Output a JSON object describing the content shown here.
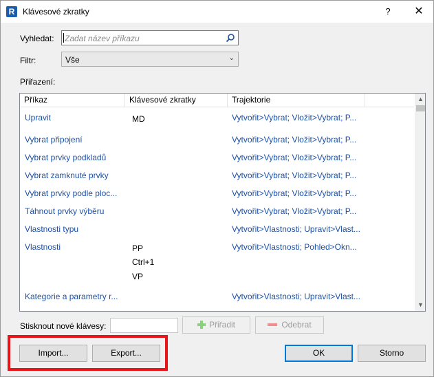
{
  "window": {
    "title": "Klávesové zkratky",
    "app_icon_letter": "R",
    "help_label": "?",
    "close_label": "✕"
  },
  "search": {
    "label": "Vyhledat:",
    "placeholder": "Zadat název příkazu",
    "icon": "search-icon"
  },
  "filter": {
    "label": "Filtr:",
    "value": "Vše",
    "chevron": "⌄"
  },
  "assignments": {
    "label": "Přiřazení:",
    "columns": [
      "Příkaz",
      "Klávesové zkratky",
      "Trajektorie"
    ],
    "rows": [
      {
        "command": "Upravit",
        "keys": [
          "MD"
        ],
        "path": "Vytvořit>Vybrat; Vložit>Vybrat; P..."
      },
      {
        "command": "Vybrat připojení",
        "keys": [],
        "path": "Vytvořit>Vybrat; Vložit>Vybrat; P..."
      },
      {
        "command": "Vybrat prvky podkladů",
        "keys": [],
        "path": "Vytvořit>Vybrat; Vložit>Vybrat; P..."
      },
      {
        "command": "Vybrat zamknuté prvky",
        "keys": [],
        "path": "Vytvořit>Vybrat; Vložit>Vybrat; P..."
      },
      {
        "command": "Vybrat prvky podle ploc...",
        "keys": [],
        "path": "Vytvořit>Vybrat; Vložit>Vybrat; P..."
      },
      {
        "command": "Táhnout prvky výběru",
        "keys": [],
        "path": "Vytvořit>Vybrat; Vložit>Vybrat; P..."
      },
      {
        "command": "Vlastnosti typu",
        "keys": [],
        "path": "Vytvořit>Vlastnosti; Upravit>Vlast..."
      },
      {
        "command": "Vlastnosti",
        "keys": [
          "PP",
          "Ctrl+1",
          "VP"
        ],
        "path": "Vytvořit>Vlastnosti; Pohled>Okn..."
      },
      {
        "command": "Kategorie a parametry r...",
        "keys": [],
        "path": "Vytvořit>Vlastnosti; Upravit>Vlast..."
      }
    ]
  },
  "new_keys": {
    "label": "Stisknout nové klávesy:",
    "assign_label": "Přiřadit",
    "remove_label": "Odebrat"
  },
  "footer": {
    "import_label": "Import...",
    "export_label": "Export...",
    "ok_label": "OK",
    "cancel_label": "Storno"
  },
  "colors": {
    "link_text": "#1a50a8",
    "highlight": "#e8141a",
    "default_button_border": "#0078d7"
  }
}
